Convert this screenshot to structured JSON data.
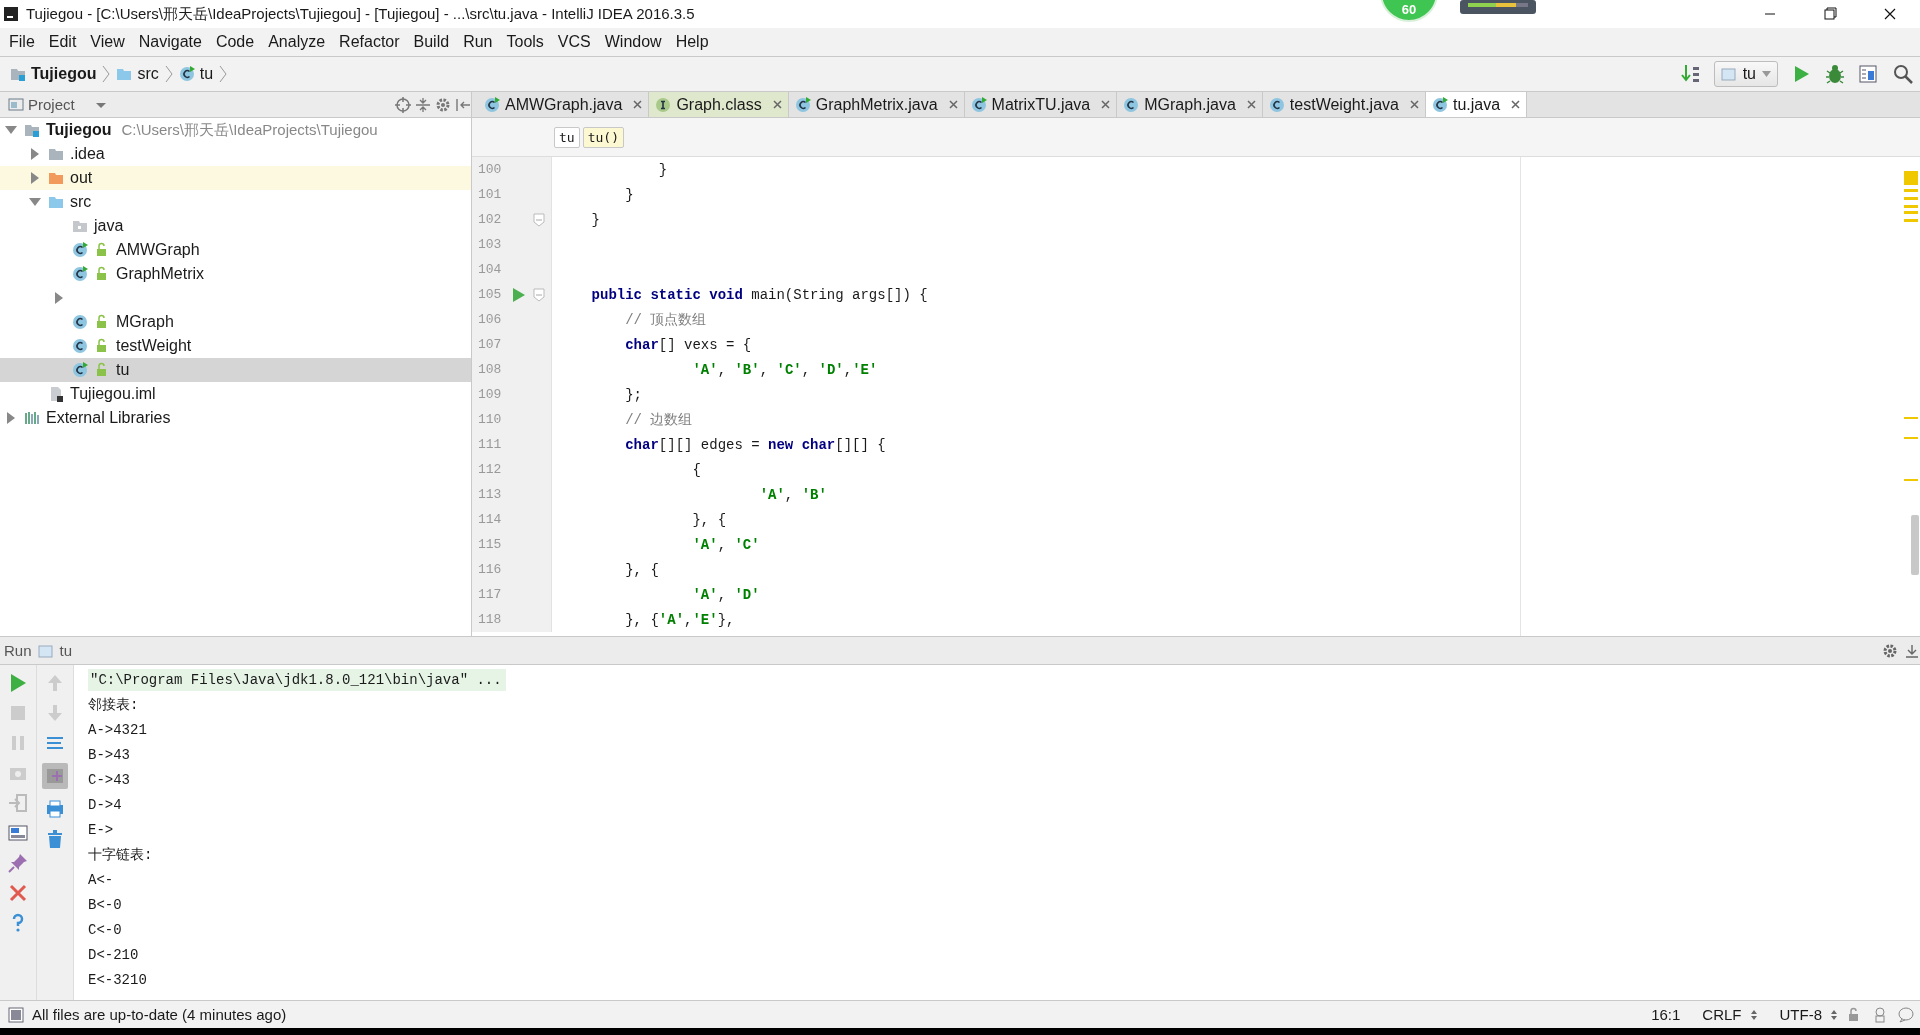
{
  "window": {
    "title": "Tujiegou - [C:\\Users\\邢天岳\\IdeaProjects\\Tujiegou] - [Tujiegou] - ...\\src\\tu.java - IntelliJ IDEA 2016.3.5"
  },
  "floating_widget": {
    "value": "60"
  },
  "menu": [
    "File",
    "Edit",
    "View",
    "Navigate",
    "Code",
    "Analyze",
    "Refactor",
    "Build",
    "Run",
    "Tools",
    "VCS",
    "Window",
    "Help"
  ],
  "navigation_bar": {
    "crumbs": [
      {
        "label": "Tujiegou",
        "kind": "project"
      },
      {
        "label": "src",
        "kind": "folder"
      },
      {
        "label": "tu",
        "kind": "class"
      }
    ],
    "run_config": "tu"
  },
  "project_panel": {
    "title": "Project",
    "tree": [
      {
        "label": "Tujiegou",
        "hint": "C:\\Users\\邢天岳\\IdeaProjects\\Tujiegou",
        "kind": "project",
        "expanded": true,
        "selected": false,
        "highlighted": false,
        "children": [
          {
            "label": ".idea",
            "kind": "folder",
            "expanded": false,
            "selected": false,
            "highlighted": false
          },
          {
            "label": "out",
            "kind": "folder-excluded",
            "expanded": false,
            "selected": false,
            "highlighted": true
          },
          {
            "label": "src",
            "kind": "folder-source",
            "expanded": true,
            "selected": false,
            "highlighted": false,
            "children": [
              {
                "label": "java",
                "kind": "package",
                "selected": false,
                "highlighted": false
              },
              {
                "label": "AMWGraph",
                "kind": "class-run",
                "selected": false,
                "highlighted": false
              },
              {
                "label": "GraphMetrix",
                "kind": "class-run",
                "selected": false,
                "highlighted": false
              },
              {
                "kind": "blank",
                "expanded": false,
                "selected": false,
                "highlighted": false
              },
              {
                "label": "MGraph",
                "kind": "class",
                "selected": false,
                "highlighted": false
              },
              {
                "label": "testWeight",
                "kind": "class",
                "selected": false,
                "highlighted": false
              },
              {
                "label": "tu",
                "kind": "class-run",
                "selected": true,
                "highlighted": false
              }
            ]
          },
          {
            "label": "Tujiegou.iml",
            "kind": "module-file",
            "selected": false,
            "highlighted": false
          }
        ]
      },
      {
        "label": "External Libraries",
        "kind": "library",
        "expanded": false,
        "selected": false,
        "highlighted": false
      }
    ]
  },
  "editor_tabs": [
    {
      "label": "AMWGraph.java",
      "kind": "class-run",
      "selected": false
    },
    {
      "label": "Graph.class",
      "kind": "interface",
      "selected": false
    },
    {
      "label": "GraphMetrix.java",
      "kind": "class-run",
      "selected": false
    },
    {
      "label": "MatrixTU.java",
      "kind": "class-run",
      "selected": false
    },
    {
      "label": "MGraph.java",
      "kind": "class",
      "selected": false
    },
    {
      "label": "testWeight.java",
      "kind": "class",
      "selected": false
    },
    {
      "label": "tu.java",
      "kind": "class-run",
      "selected": true
    }
  ],
  "editor": {
    "breadcrumbs": [
      {
        "label": "tu",
        "selected": false
      },
      {
        "label": "tu()",
        "selected": true
      }
    ],
    "lines": [
      {
        "number": "100",
        "run_marker": false,
        "fold_marker": false,
        "tokens": [
          {
            "kind": "plain",
            "text": "            }"
          }
        ]
      },
      {
        "number": "101",
        "run_marker": false,
        "fold_marker": false,
        "tokens": [
          {
            "kind": "plain",
            "text": "        }"
          }
        ]
      },
      {
        "number": "102",
        "run_marker": false,
        "fold_marker": true,
        "tokens": [
          {
            "kind": "plain",
            "text": "    }"
          }
        ]
      },
      {
        "number": "103",
        "run_marker": false,
        "fold_marker": false
      },
      {
        "number": "104",
        "run_marker": false,
        "fold_marker": false
      },
      {
        "number": "105",
        "run_marker": true,
        "fold_marker": true,
        "tokens": [
          {
            "kind": "keyword",
            "text": "    public static void"
          },
          {
            "kind": "plain",
            "text": " main(String args[]) {"
          }
        ]
      },
      {
        "number": "106",
        "run_marker": false,
        "fold_marker": false,
        "tokens": [
          {
            "kind": "comment",
            "text": "        // 顶点数组"
          }
        ]
      },
      {
        "number": "107",
        "run_marker": false,
        "fold_marker": false,
        "tokens": [
          {
            "kind": "keyword",
            "text": "        char"
          },
          {
            "kind": "plain",
            "text": "[] vexs = {"
          }
        ]
      },
      {
        "number": "108",
        "run_marker": false,
        "fold_marker": false,
        "tokens": [
          {
            "kind": "string",
            "text": "                'A'"
          },
          {
            "kind": "plain",
            "text": ", "
          },
          {
            "kind": "string",
            "text": "'B'"
          },
          {
            "kind": "plain",
            "text": ", "
          },
          {
            "kind": "string",
            "text": "'C'"
          },
          {
            "kind": "plain",
            "text": ", "
          },
          {
            "kind": "string",
            "text": "'D'"
          },
          {
            "kind": "plain",
            "text": ","
          },
          {
            "kind": "string",
            "text": "'E'"
          }
        ]
      },
      {
        "number": "109",
        "run_marker": false,
        "fold_marker": false,
        "tokens": [
          {
            "kind": "plain",
            "text": "        };"
          }
        ]
      },
      {
        "number": "110",
        "run_marker": false,
        "fold_marker": false,
        "tokens": [
          {
            "kind": "comment",
            "text": "        // 边数组"
          }
        ]
      },
      {
        "number": "111",
        "run_marker": false,
        "fold_marker": false,
        "tokens": [
          {
            "kind": "keyword",
            "text": "        char"
          },
          {
            "kind": "plain",
            "text": "[][] edges = "
          },
          {
            "kind": "keyword",
            "text": "new char"
          },
          {
            "kind": "plain",
            "text": "[][] {"
          }
        ]
      },
      {
        "number": "112",
        "run_marker": false,
        "fold_marker": false,
        "tokens": [
          {
            "kind": "plain",
            "text": "                {"
          }
        ]
      },
      {
        "number": "113",
        "run_marker": false,
        "fold_marker": false,
        "tokens": [
          {
            "kind": "string",
            "text": "                        'A'"
          },
          {
            "kind": "plain",
            "text": ", "
          },
          {
            "kind": "string",
            "text": "'B'"
          }
        ]
      },
      {
        "number": "114",
        "run_marker": false,
        "fold_marker": false,
        "tokens": [
          {
            "kind": "plain",
            "text": "                }, {"
          }
        ]
      },
      {
        "number": "115",
        "run_marker": false,
        "fold_marker": false,
        "tokens": [
          {
            "kind": "string",
            "text": "                'A'"
          },
          {
            "kind": "plain",
            "text": ", "
          },
          {
            "kind": "string",
            "text": "'C'"
          }
        ]
      },
      {
        "number": "116",
        "run_marker": false,
        "fold_marker": false,
        "tokens": [
          {
            "kind": "plain",
            "text": "        }, {"
          }
        ]
      },
      {
        "number": "117",
        "run_marker": false,
        "fold_marker": false,
        "tokens": [
          {
            "kind": "string",
            "text": "                'A'"
          },
          {
            "kind": "plain",
            "text": ", "
          },
          {
            "kind": "string",
            "text": "'D'"
          }
        ]
      },
      {
        "number": "118",
        "run_marker": false,
        "fold_marker": false,
        "tokens": [
          {
            "kind": "plain",
            "text": "        }, {"
          },
          {
            "kind": "string",
            "text": "'A'"
          },
          {
            "kind": "plain",
            "text": ","
          },
          {
            "kind": "string",
            "text": "'E'"
          },
          {
            "kind": "plain",
            "text": "},"
          }
        ]
      }
    ]
  },
  "run_panel": {
    "title": "Run",
    "config": "tu",
    "output": [
      {
        "kind": "command",
        "text": "\"C:\\Program Files\\Java\\jdk1.8.0_121\\bin\\java\" ..."
      },
      {
        "kind": "output",
        "text": "邻接表:"
      },
      {
        "kind": "output",
        "text": "A->4321"
      },
      {
        "kind": "output",
        "text": "B->43"
      },
      {
        "kind": "output",
        "text": "C->43"
      },
      {
        "kind": "output",
        "text": "D->4"
      },
      {
        "kind": "output",
        "text": "E->"
      },
      {
        "kind": "output",
        "text": "十字链表:"
      },
      {
        "kind": "output",
        "text": "A<-"
      },
      {
        "kind": "output",
        "text": "B<-0"
      },
      {
        "kind": "output",
        "text": "C<-0"
      },
      {
        "kind": "output",
        "text": "D<-210"
      },
      {
        "kind": "output",
        "text": "E<-3210"
      }
    ]
  },
  "status_bar": {
    "message": "All files are up-to-date (4 minutes ago)",
    "position": "16:1",
    "line_separator": "CRLF",
    "encoding": "UTF-8"
  }
}
